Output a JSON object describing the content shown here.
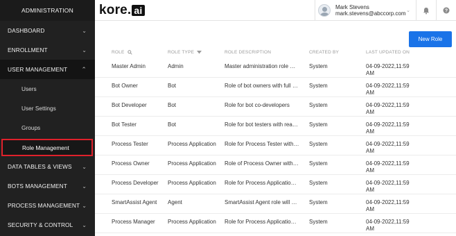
{
  "sidebar": {
    "title": "ADMINISTRATION",
    "items": [
      {
        "label": "DASHBOARD"
      },
      {
        "label": "ENROLLMENT"
      },
      {
        "label": "USER MANAGEMENT"
      },
      {
        "label": "DATA TABLES & VIEWS"
      },
      {
        "label": "BOTS MANAGEMENT"
      },
      {
        "label": "PROCESS MANAGEMENT"
      },
      {
        "label": "SECURITY & CONTROL"
      }
    ],
    "sub_items": [
      {
        "label": "Users"
      },
      {
        "label": "User Settings"
      },
      {
        "label": "Groups"
      },
      {
        "label": "Role Management"
      }
    ]
  },
  "header": {
    "logo_text": "kore.",
    "logo_suffix": "ai",
    "user_name": "Mark Stevens",
    "user_email": "mark.stevens@abccorp.com",
    "notification_icon": "bell-icon",
    "help_icon": "help-icon"
  },
  "main": {
    "new_role_label": "New Role",
    "columns": [
      "ROLE",
      "ROLE TYPE",
      "ROLE DESCRIPTION",
      "CREATED BY",
      "LAST UPDATED ON"
    ],
    "rows": [
      {
        "role": "Master Admin",
        "type": "Admin",
        "desc": "Master administration role wit...",
        "by": "System",
        "date": "04-09-2022,11:59",
        "time": "AM"
      },
      {
        "role": "Bot Owner",
        "type": "Bot",
        "desc": "Role of bot owners with full acc...",
        "by": "System",
        "date": "04-09-2022,11:59",
        "time": "AM"
      },
      {
        "role": "Bot Developer",
        "type": "Bot",
        "desc": "Role for bot co-developers",
        "by": "System",
        "date": "04-09-2022,11:59",
        "time": "AM"
      },
      {
        "role": "Bot Tester",
        "type": "Bot",
        "desc": "Role for bot testers with read-...",
        "by": "System",
        "date": "04-09-2022,11:59",
        "time": "AM"
      },
      {
        "role": "Process Tester",
        "type": "Process Application",
        "desc": "Role for Process Tester with re...",
        "by": "System",
        "date": "04-09-2022,11:59",
        "time": "AM"
      },
      {
        "role": "Process Owner",
        "type": "Process Application",
        "desc": "Role of Process Owner with ful...",
        "by": "System",
        "date": "04-09-2022,11:59",
        "time": "AM"
      },
      {
        "role": "Process Developer",
        "type": "Process Application",
        "desc": "Role for Process Application co...",
        "by": "System",
        "date": "04-09-2022,11:59",
        "time": "AM"
      },
      {
        "role": "SmartAssist Agent",
        "type": "Agent",
        "desc": "SmartAssist Agent role will avail...",
        "by": "System",
        "date": "04-09-2022,11:59",
        "time": "AM"
      },
      {
        "role": "Process Manager",
        "type": "Process Application",
        "desc": "Role for Process Application M...",
        "by": "System",
        "date": "04-09-2022,11:59",
        "time": "AM"
      }
    ]
  },
  "colors": {
    "sidebar_bg": "#212121",
    "accent": "#1a73e8",
    "highlight": "#e0212b"
  }
}
